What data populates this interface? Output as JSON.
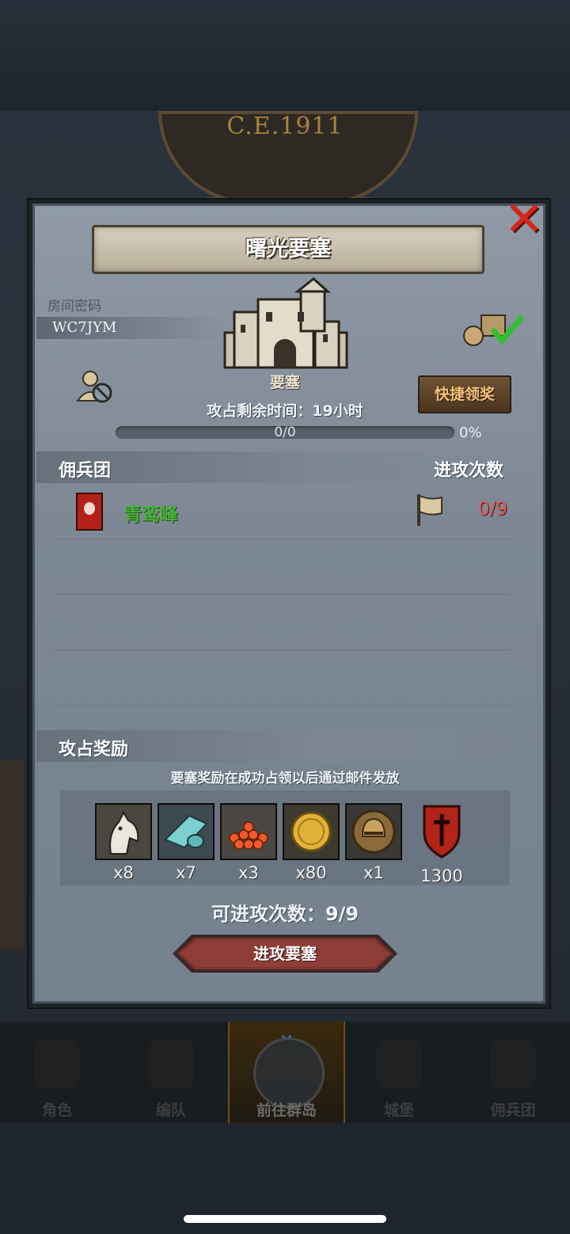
{
  "background": {
    "era_text": "C.E.1911"
  },
  "panel": {
    "title": "曙光要塞",
    "room_label": "房间密码",
    "room_code": "WC7JYM",
    "fortress_label": "要塞",
    "quick_claim_label": "快捷领奖",
    "remaining_time_text": "攻占剩余时间：19小时",
    "progress": {
      "text": "0/0",
      "percent_text": "0%",
      "fraction": 0
    },
    "mercenary_header": "佣兵团",
    "attack_count_header": "进攻次数",
    "mercenaries": [
      {
        "name": "青鸾峰",
        "attacks": "0/9"
      }
    ],
    "rewards_header": "攻占奖励",
    "rewards_note": "要塞奖励在成功占领以后通过邮件发放",
    "rewards": [
      {
        "icon": "horse-icon",
        "qty": "x8"
      },
      {
        "icon": "cloth-icon",
        "qty": "x7"
      },
      {
        "icon": "berries-icon",
        "qty": "x3"
      },
      {
        "icon": "gold-coin-icon",
        "qty": "x80"
      },
      {
        "icon": "helmet-icon",
        "qty": "x1"
      },
      {
        "icon": "red-shield-icon",
        "qty": "1300"
      }
    ],
    "attempts_text": "可进攻次数：9/9",
    "attack_button": "进攻要塞"
  },
  "nav": [
    {
      "label": "角色"
    },
    {
      "label": "编队"
    },
    {
      "label": "前往群岛",
      "active": true
    },
    {
      "label": "城堡"
    },
    {
      "label": "佣兵团"
    }
  ],
  "colors": {
    "accent_red": "#d7251c",
    "merc_green": "#49b33b",
    "count_red": "#e35454",
    "quick_btn_text": "#f5c27a"
  }
}
